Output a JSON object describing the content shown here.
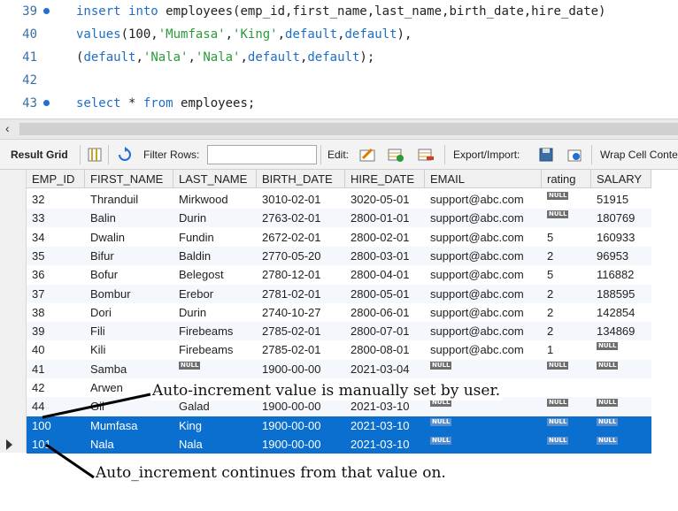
{
  "editor": {
    "lines": [
      {
        "num": "39",
        "dot": true,
        "parts": [
          {
            "t": "kw",
            "v": "insert"
          },
          {
            "t": "p",
            "v": " "
          },
          {
            "t": "kw",
            "v": "into"
          },
          {
            "t": "p",
            "v": " employees(emp_id,first_name,last_name,birth_date,hire_date)"
          }
        ]
      },
      {
        "num": "40",
        "dot": false,
        "parts": [
          {
            "t": "kw",
            "v": "values"
          },
          {
            "t": "p",
            "v": "(100,"
          },
          {
            "t": "str",
            "v": "'Mumfasa'"
          },
          {
            "t": "p",
            "v": ","
          },
          {
            "t": "str",
            "v": "'King'"
          },
          {
            "t": "p",
            "v": ","
          },
          {
            "t": "kw",
            "v": "default"
          },
          {
            "t": "p",
            "v": ","
          },
          {
            "t": "kw",
            "v": "default"
          },
          {
            "t": "p",
            "v": "),"
          }
        ]
      },
      {
        "num": "41",
        "dot": false,
        "parts": [
          {
            "t": "p",
            "v": "("
          },
          {
            "t": "kw",
            "v": "default"
          },
          {
            "t": "p",
            "v": ","
          },
          {
            "t": "str",
            "v": "'Nala'"
          },
          {
            "t": "p",
            "v": ","
          },
          {
            "t": "str",
            "v": "'Nala'"
          },
          {
            "t": "p",
            "v": ","
          },
          {
            "t": "kw",
            "v": "default"
          },
          {
            "t": "p",
            "v": ","
          },
          {
            "t": "kw",
            "v": "default"
          },
          {
            "t": "p",
            "v": ");"
          }
        ]
      },
      {
        "num": "42",
        "dot": false,
        "parts": []
      },
      {
        "num": "43",
        "dot": true,
        "parts": [
          {
            "t": "kw",
            "v": "select"
          },
          {
            "t": "p",
            "v": " * "
          },
          {
            "t": "kw",
            "v": "from"
          },
          {
            "t": "p",
            "v": " employees;"
          }
        ]
      }
    ]
  },
  "toolbar": {
    "result_grid": "Result Grid",
    "filter_rows": "Filter Rows:",
    "edit": "Edit:",
    "export_import": "Export/Import:",
    "wrap_cell": "Wrap Cell Conte"
  },
  "grid": {
    "columns": [
      "EMP_ID",
      "FIRST_NAME",
      "LAST_NAME",
      "BIRTH_DATE",
      "HIRE_DATE",
      "EMAIL",
      "rating",
      "SALARY"
    ],
    "null_label": "NULL",
    "rows": [
      [
        "32",
        "Thranduil",
        "Mirkwood",
        "3010-02-01",
        "3020-05-01",
        "support@abc.com",
        null,
        "51915"
      ],
      [
        "33",
        "Balin",
        "Durin",
        "2763-02-01",
        "2800-01-01",
        "support@abc.com",
        null,
        "180769"
      ],
      [
        "34",
        "Dwalin",
        "Fundin",
        "2672-02-01",
        "2800-02-01",
        "support@abc.com",
        "5",
        "160933"
      ],
      [
        "35",
        "Bifur",
        "Baldin",
        "2770-05-20",
        "2800-03-01",
        "support@abc.com",
        "2",
        "96953"
      ],
      [
        "36",
        "Bofur",
        "Belegost",
        "2780-12-01",
        "2800-04-01",
        "support@abc.com",
        "5",
        "116882"
      ],
      [
        "37",
        "Bombur",
        "Erebor",
        "2781-02-01",
        "2800-05-01",
        "support@abc.com",
        "2",
        "188595"
      ],
      [
        "38",
        "Dori",
        "Durin",
        "2740-10-27",
        "2800-06-01",
        "support@abc.com",
        "2",
        "142854"
      ],
      [
        "39",
        "Fili",
        "Firebeams",
        "2785-02-01",
        "2800-07-01",
        "support@abc.com",
        "2",
        "134869"
      ],
      [
        "40",
        "Kili",
        "Firebeams",
        "2785-02-01",
        "2800-08-01",
        "support@abc.com",
        "1",
        null
      ],
      [
        "41",
        "Samba",
        null,
        "1900-00-00",
        "2021-03-04",
        null,
        null,
        null
      ],
      [
        "42",
        "Arwen",
        "",
        "",
        "",
        "",
        "",
        ""
      ],
      [
        "44",
        "Gil",
        "Galad",
        "1900-00-00",
        "2021-03-10",
        null,
        null,
        null
      ],
      [
        "100",
        "Mumfasa",
        "King",
        "1900-00-00",
        "2021-03-10",
        null,
        null,
        null
      ],
      [
        "101",
        "Nala",
        "Nala",
        "1900-00-00",
        "2021-03-10",
        null,
        null,
        null
      ]
    ],
    "selected_rows": [
      "100",
      "101"
    ]
  },
  "annotations": {
    "top": "Auto-increment value is manually set by user.",
    "bottom": "Auto_increment continues from that value on."
  },
  "colors": {
    "keyword": "#1e6ec7",
    "string": "#2b9a3a",
    "selection": "#0a6fcf"
  }
}
